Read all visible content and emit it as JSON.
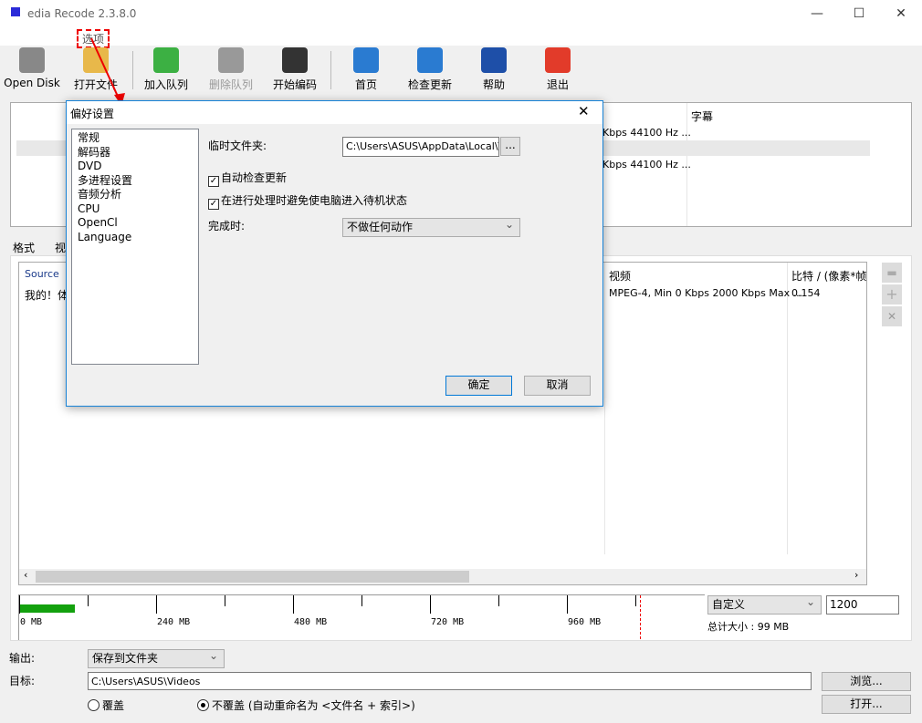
{
  "window": {
    "title": "edia Recode 2.3.8.0",
    "menu_item": "选项",
    "min": "—",
    "max": "☐",
    "close": "✕"
  },
  "toolbar": [
    {
      "label": "Open Disk",
      "icon": "dvd-icon",
      "color": "#888"
    },
    {
      "label": "打开文件",
      "icon": "folder-icon",
      "color": "#e8b84a"
    },
    {
      "label": "加入队列",
      "icon": "add-icon",
      "color": "#3cb043"
    },
    {
      "label": "删除队列",
      "icon": "remove-icon",
      "color": "#999"
    },
    {
      "label": "开始编码",
      "icon": "encode-icon",
      "color": "#333"
    },
    {
      "label": "首页",
      "icon": "globe-icon",
      "color": "#2a7bd1"
    },
    {
      "label": "检查更新",
      "icon": "refresh-icon",
      "color": "#2a7bd1"
    },
    {
      "label": "帮助",
      "icon": "help-icon",
      "color": "#1e4fa8"
    },
    {
      "label": "退出",
      "icon": "power-icon",
      "color": "#e23b2a"
    }
  ],
  "top_table": {
    "subtitle_header": "字幕",
    "rows": [
      "Kbps 44100 Hz ...",
      "Kbps 44100 Hz ..."
    ]
  },
  "tabs": [
    "格式",
    "视"
  ],
  "queue": {
    "headers": {
      "source": "Source",
      "video": "视频",
      "ratio": "比特 / (像素*帧"
    },
    "row": {
      "source": "我的！体",
      "video": "MPEG-4, Min 0 Kbps 2000 Kbps Max ...",
      "ratio": "0.154"
    }
  },
  "size_bar": {
    "ticks": [
      "0 MB",
      "240 MB",
      "480 MB",
      "720 MB",
      "960 MB"
    ],
    "used_fraction": 0.08,
    "preset": "自定义",
    "value": "1200",
    "total_label": "总计大小 : 99 MB"
  },
  "output": {
    "output_label": "输出:",
    "output_value": "保存到文件夹",
    "target_label": "目标:",
    "target_value": "C:\\Users\\ASUS\\Videos",
    "browse": "浏览...",
    "open": "打开...",
    "overwrite": "覆盖",
    "no_overwrite": "不覆盖 (自动重命名为 <文件名 + 索引>)"
  },
  "dialog": {
    "title": "偏好设置",
    "close": "✕",
    "nav": [
      "常规",
      "解码器",
      "DVD",
      "多进程设置",
      "音频分析",
      "CPU",
      "OpenCl",
      "Language"
    ],
    "temp_label": "临时文件夹:",
    "temp_value": "C:\\Users\\ASUS\\AppData\\Local\\Temp",
    "browse": "...",
    "auto_update": "自动检查更新",
    "prevent_sleep": "在进行处理时避免使电脑进入待机状态",
    "finish_label": "完成时:",
    "finish_value": "不做任何动作",
    "ok": "确定",
    "cancel": "取消"
  }
}
